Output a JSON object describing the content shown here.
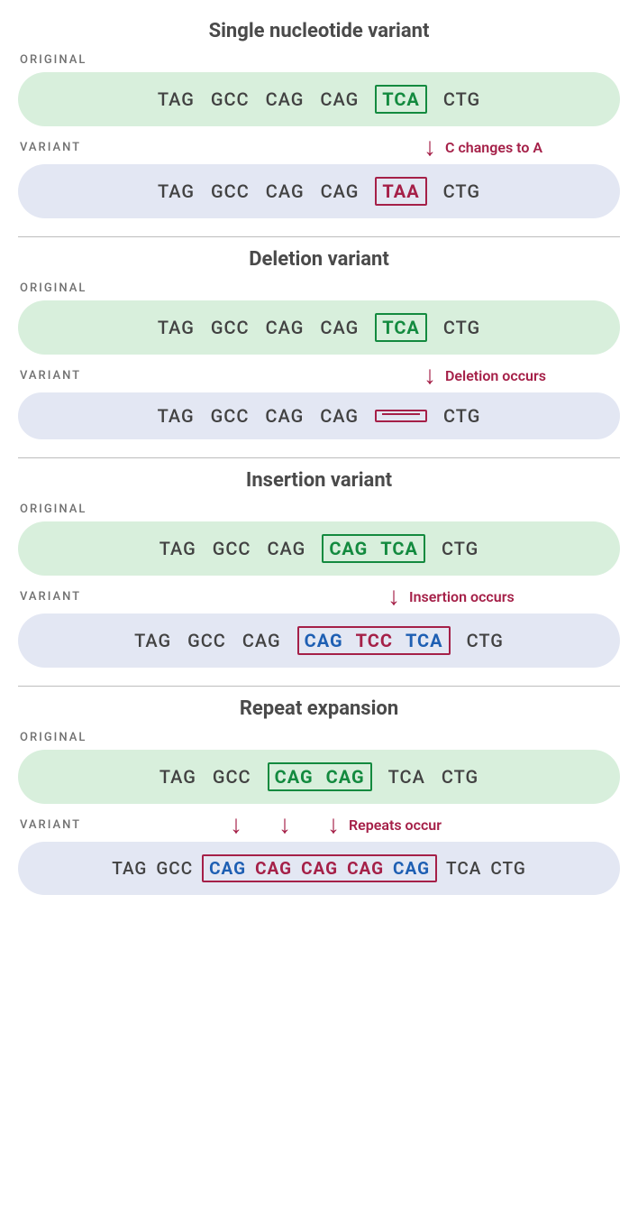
{
  "labels": {
    "original": "ORIGINAL",
    "variant": "VARIANT"
  },
  "codons": {
    "tag": "TAG",
    "gcc": "GCC",
    "cag": "CAG",
    "tca": "TCA",
    "ctg": "CTG",
    "taa": "TAA",
    "tcc": "TCC"
  },
  "snv": {
    "title": "Single nucleotide variant",
    "change_label": "C changes to A"
  },
  "deletion": {
    "title": "Deletion variant",
    "change_label": "Deletion occurs"
  },
  "insertion": {
    "title": "Insertion variant",
    "change_label": "Insertion occurs"
  },
  "repeat": {
    "title": "Repeat expansion",
    "change_label": "Repeats occur"
  }
}
